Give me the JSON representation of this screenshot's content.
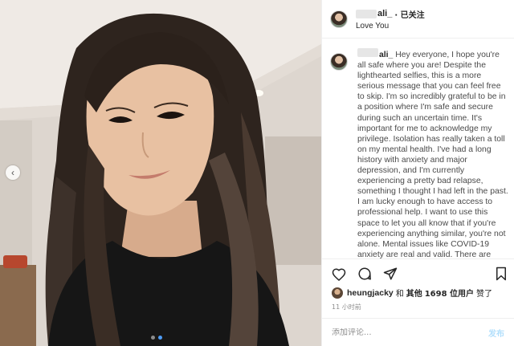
{
  "post": {
    "username": "ali_",
    "follow_status": "· 已关注",
    "location": "Love You",
    "caption_user": "ali_",
    "caption": "Hey everyone, I hope you're all safe where you are! Despite the lighthearted selfies, this is a more serious message that you can feel free to skip. I'm so incredibly grateful to be in a position where I'm safe and secure during such an uncertain time. It's important for me to acknowledge my privilege. Isolation has really taken a toll on my mental health. I've had a long history with anxiety and major depression, and I'm currently experiencing a pretty bad relapse, something I thought I had left in the past. I am lucky enough to have access to professional help. I want to use this space to let you all know that if you're experiencing anything similar, you're not alone. Mental issues like COVID-19 anxiety are real and valid. There are",
    "likes": {
      "user": "heungjacky",
      "and_text": "和",
      "others_label": "其他",
      "count_text": "1698 位用户",
      "liked_text": "赞了"
    },
    "time_ago": "11 小时前",
    "comment": {
      "placeholder": "添加评论...",
      "post_label": "发布"
    }
  },
  "carousel": {
    "slide_count": 2,
    "active_index": 1
  },
  "icons": {
    "like": "heart-icon",
    "comment": "comment-icon",
    "share": "send-icon",
    "save": "bookmark-icon",
    "carousel_prev": "chevron-left-icon"
  },
  "colors": {
    "link_blue": "#0095f6",
    "post_disabled": "#b2dffc",
    "active_dot": "#4e9cf6"
  }
}
